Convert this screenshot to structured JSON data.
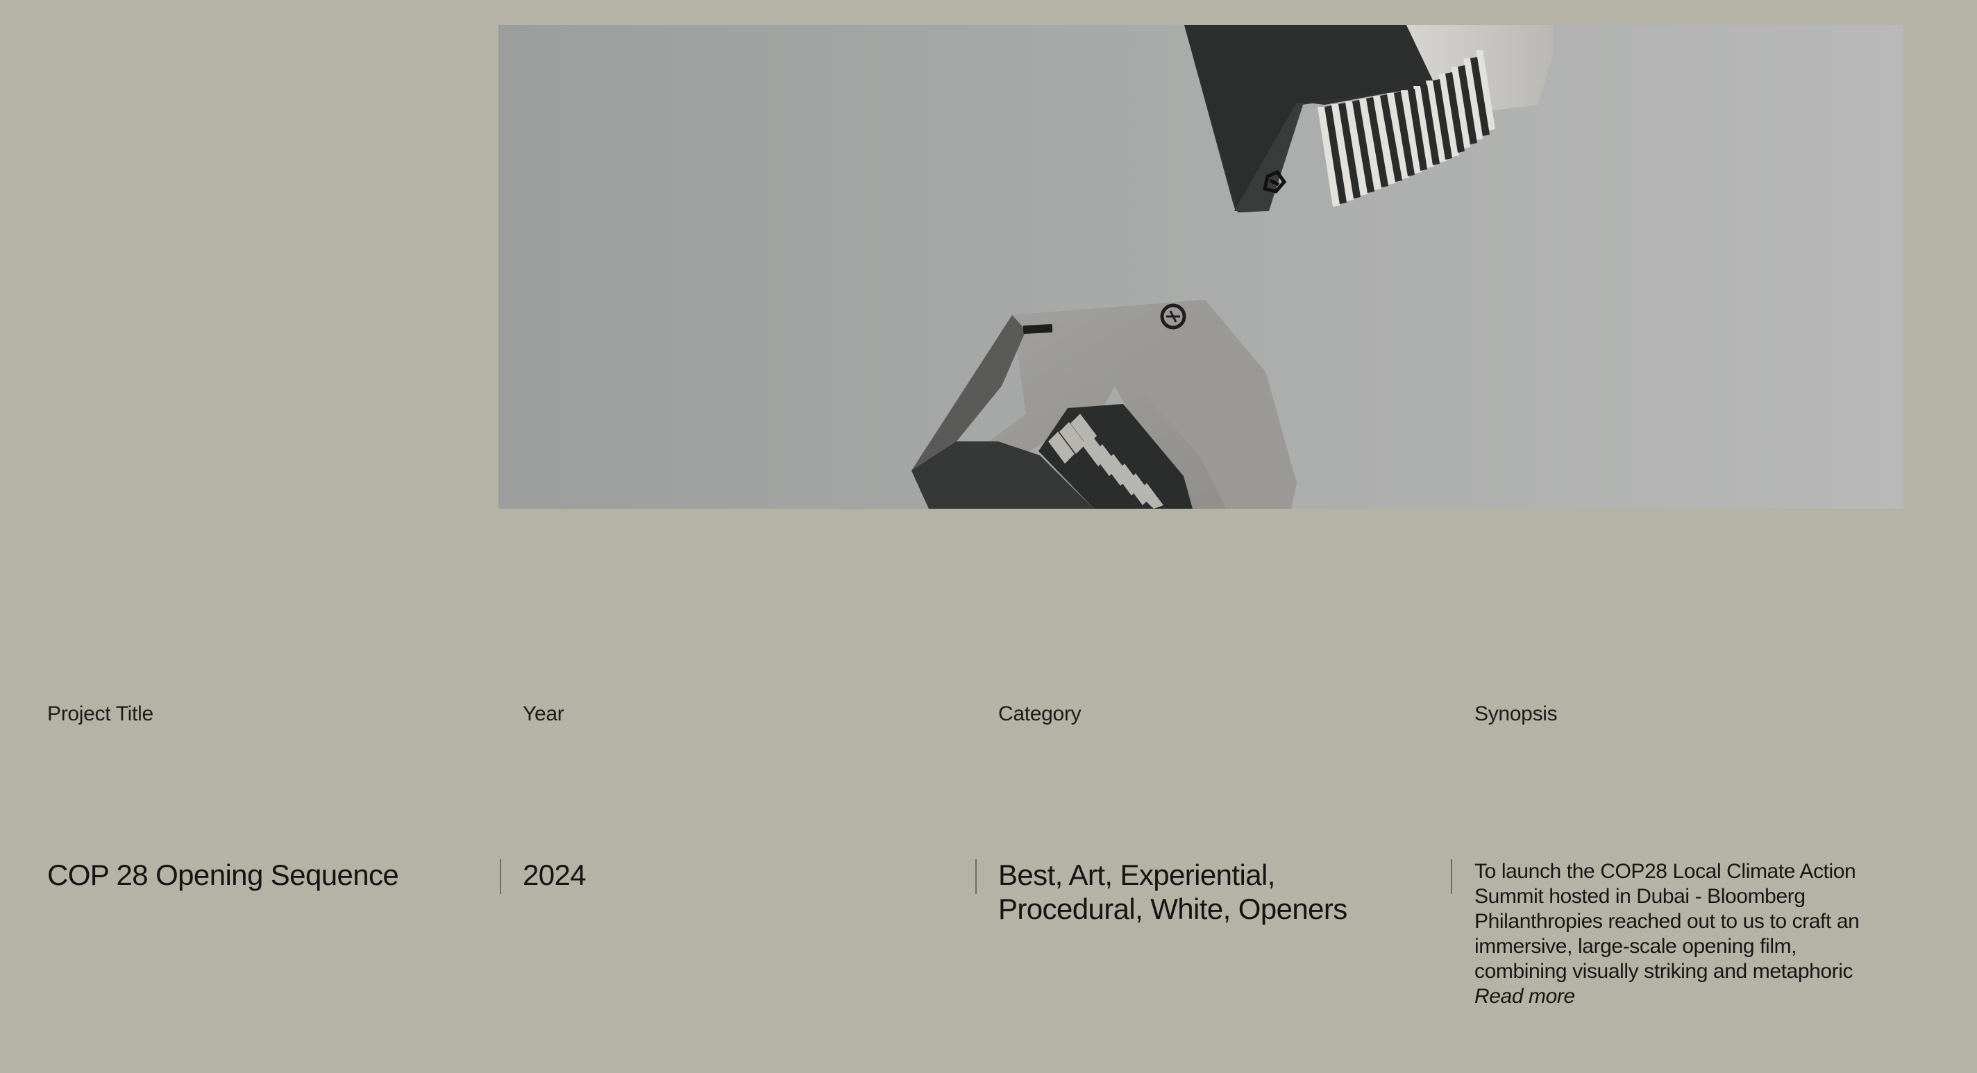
{
  "project": {
    "labels": {
      "title": "Project Title",
      "year": "Year",
      "category": "Category",
      "synopsis": "Synopsis"
    },
    "values": {
      "title": "COP 28 Opening Sequence",
      "year": "2024",
      "category": "Best, Art, Experiential, Procedural, White, Openers",
      "synopsis": "To launch the COP28 Local Climate Action Summit hosted in Dubai - Bloomberg Philanthropies reached out to us to craft an immersive, large-scale opening film, combining visually striking and metaphoric",
      "read_more": "Read more"
    }
  },
  "colors": {
    "background": "#b5b3a5",
    "text": "#1a1a1a",
    "divider": "#6e6d65"
  },
  "hero_image": {
    "subject": "floating concrete blocks with carved staircases"
  }
}
